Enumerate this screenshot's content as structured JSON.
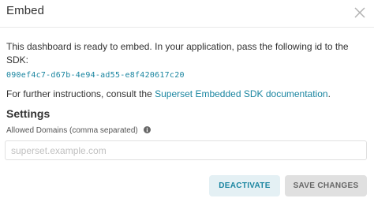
{
  "modal": {
    "title": "Embed",
    "close_icon": "close-icon"
  },
  "body": {
    "ready_text": "This dashboard is ready to embed. In your application, pass the following id to the SDK:",
    "embed_id": "090ef4c7-d67b-4e94-ad55-e8f420617c20",
    "instructions_prefix": "For further instructions, consult the ",
    "docs_link_label": "Superset Embedded SDK documentation",
    "instructions_suffix": "."
  },
  "settings": {
    "title": "Settings",
    "allowed_domains_label": "Allowed Domains (comma separated)",
    "info_icon": "info-icon",
    "allowed_domains_value": "",
    "allowed_domains_placeholder": "superset.example.com"
  },
  "actions": {
    "deactivate_label": "DEACTIVATE",
    "save_label": "SAVE CHANGES"
  },
  "colors": {
    "accent": "#1a85a0",
    "deactivate_bg": "#e4f0f4",
    "save_bg": "#e0e0e0"
  }
}
